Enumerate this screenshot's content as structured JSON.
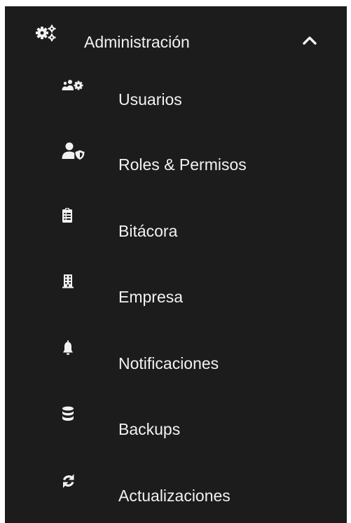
{
  "menu": {
    "group": {
      "label": "Administración",
      "icon": "gears-icon",
      "expanded": true
    },
    "items": [
      {
        "label": "Usuarios",
        "icon": "users-cog-icon"
      },
      {
        "label": "Roles & Permisos",
        "icon": "user-shield-icon"
      },
      {
        "label": "Bitácora",
        "icon": "clipboard-list-icon"
      },
      {
        "label": "Empresa",
        "icon": "building-icon"
      },
      {
        "label": "Notificaciones",
        "icon": "bell-icon"
      },
      {
        "label": "Backups",
        "icon": "database-icon"
      },
      {
        "label": "Actualizaciones",
        "icon": "sync-icon"
      }
    ]
  },
  "colors": {
    "background": "#1c1c1c",
    "text": "#f2f2f2"
  }
}
